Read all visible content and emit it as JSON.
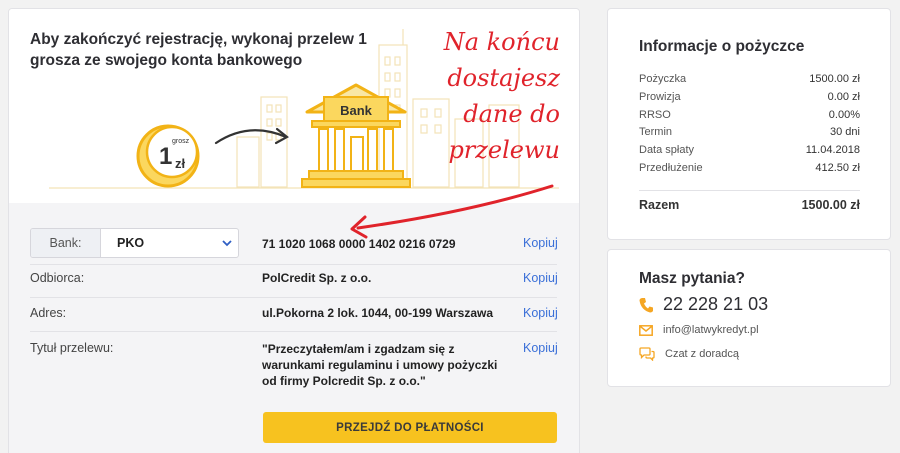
{
  "hero": {
    "title": "Aby zakończyć rejestrację, wykonaj przelew 1 grosza ze swojego konta bankowego",
    "coin_amount": "1",
    "coin_unit_top": "grosz",
    "coin_unit_bottom": "zł",
    "bank_sign": "Bank"
  },
  "annotation": {
    "lines": [
      "Na końcu",
      "dostajesz",
      "dane do",
      "przelewu"
    ]
  },
  "transfer": {
    "bank_label": "Bank:",
    "bank_value": "PKO",
    "account_number": "71 1020 1068 0000 1402 0216 0729",
    "recipient_label": "Odbiorca:",
    "recipient_value": "PolCredit Sp. z o.o.",
    "address_label": "Adres:",
    "address_value": "ul.Pokorna 2 lok. 1044, 00-199 Warszawa",
    "title_label": "Tytuł przelewu:",
    "title_value": "\"Przeczytałem/am i zgadzam się z warunkami regulaminu i umowy pożyczki od firmy Polcredit Sp. z o.o.\"",
    "copy_label": "Kopiuj",
    "pay_button": "PRZEJDŹ DO PŁATNOŚCI"
  },
  "loan_info": {
    "title": "Informacje o pożyczce",
    "rows": [
      {
        "label": "Pożyczka",
        "value": "1500.00 zł"
      },
      {
        "label": "Prowizja",
        "value": "0.00 zł"
      },
      {
        "label": "RRSO",
        "value": "0.00%"
      },
      {
        "label": "Termin",
        "value": "30 dni"
      },
      {
        "label": "Data spłaty",
        "value": "11.04.2018"
      },
      {
        "label": "Przedłużenie",
        "value": "412.50 zł"
      }
    ],
    "total_label": "Razem",
    "total_value": "1500.00 zł"
  },
  "contact": {
    "title": "Masz pytania?",
    "phone": "22 228 21 03",
    "email": "info@latwykredyt.pl",
    "chat": "Czat z doradcą",
    "icon_color": "#f5a623"
  },
  "colors": {
    "accent_yellow": "#f7c21f",
    "link_blue": "#3a6fd8",
    "annotation_red": "#e0232b"
  }
}
